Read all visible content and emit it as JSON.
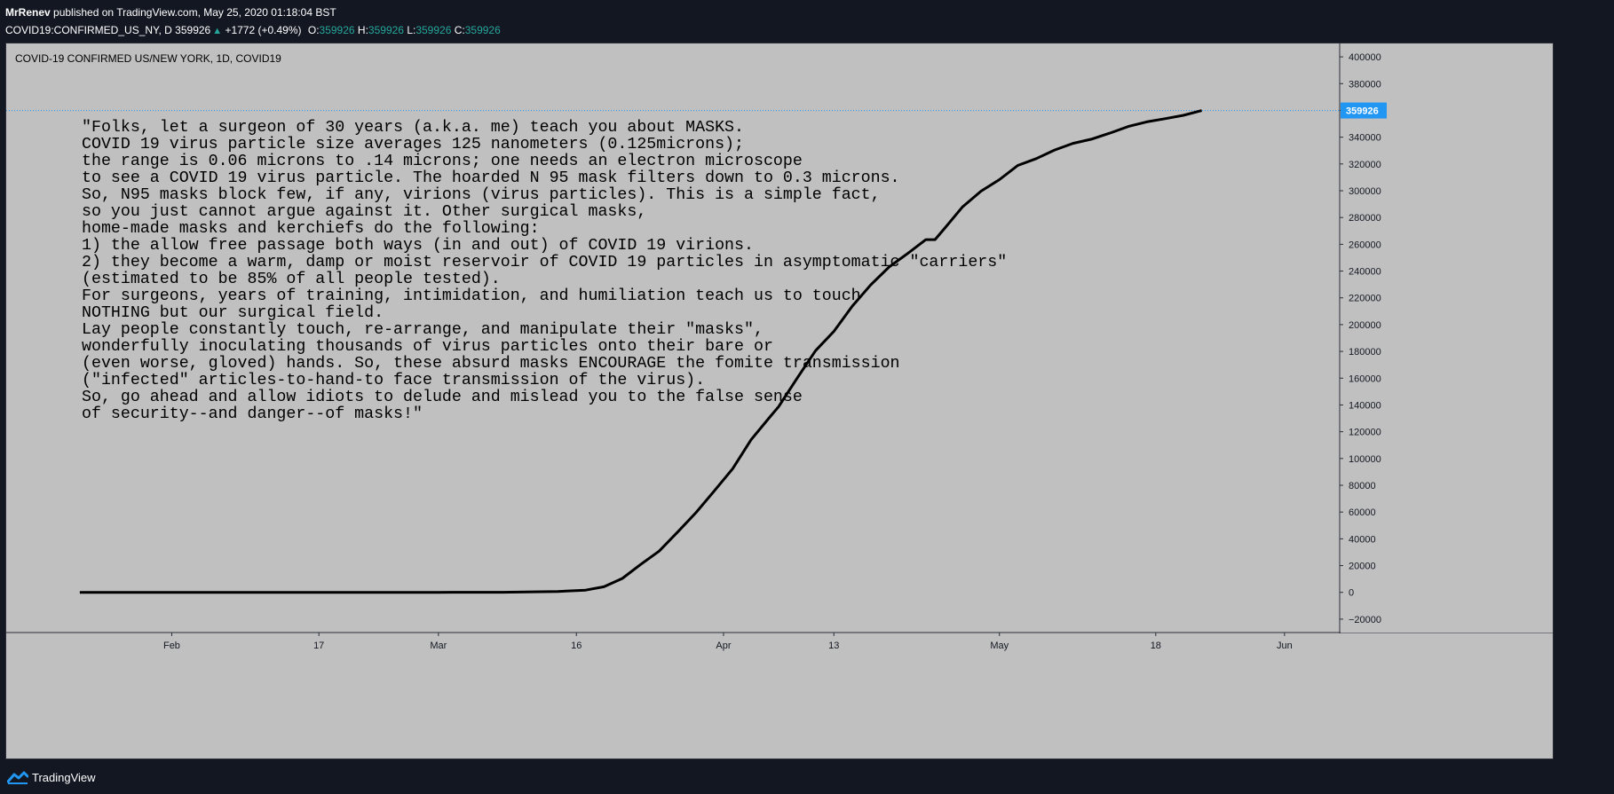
{
  "header": {
    "author": "MrRenev",
    "published": "published on TradingView.com, May 25, 2020 01:18:04 BST",
    "symbol": "COVID19:CONFIRMED_US_NY, D",
    "last": "359926",
    "change_arrow": "▲",
    "change": "+1772 (+0.49%)",
    "open_label": "O:",
    "open": "359926",
    "high_label": "H:",
    "high": "359926",
    "low_label": "L:",
    "low": "359926",
    "close_label": "C:",
    "close": "359926"
  },
  "footer": {
    "brand": "TradingView",
    "logo_icon": "tradingview-logo-icon"
  },
  "colors": {
    "background": "#131722",
    "plot_background": "#c0c0c0",
    "line": "#000000",
    "price_label": "#2196f3",
    "up": "#26a69a"
  },
  "chart_data": {
    "type": "line",
    "title": "COVID-19 CONFIRMED US/NEW YORK, 1D, COVID19",
    "ylim": [
      -30000,
      410000
    ],
    "y_ticks": [
      -20000,
      0,
      20000,
      40000,
      60000,
      80000,
      100000,
      120000,
      140000,
      160000,
      180000,
      200000,
      220000,
      240000,
      260000,
      280000,
      300000,
      320000,
      340000,
      360000,
      380000,
      400000
    ],
    "y_tick_labels": [
      "−20000",
      "0",
      "20000",
      "40000",
      "60000",
      "80000",
      "100000",
      "120000",
      "140000",
      "160000",
      "180000",
      "200000",
      "220000",
      "240000",
      "260000",
      "280000",
      "300000",
      "320000",
      "340000",
      "360000",
      "380000",
      "400000"
    ],
    "xlim": [
      "2020-01-14",
      "2020-06-07"
    ],
    "x_ticks": [
      {
        "date": "2020-02-01",
        "label": "Feb"
      },
      {
        "date": "2020-02-17",
        "label": "17"
      },
      {
        "date": "2020-03-01",
        "label": "Mar"
      },
      {
        "date": "2020-03-16",
        "label": "16"
      },
      {
        "date": "2020-04-01",
        "label": "Apr"
      },
      {
        "date": "2020-04-13",
        "label": "13"
      },
      {
        "date": "2020-05-01",
        "label": "May"
      },
      {
        "date": "2020-05-18",
        "label": "18"
      },
      {
        "date": "2020-06-01",
        "label": "Jun"
      }
    ],
    "last_value_label": "359926",
    "last_value": 359926,
    "series": [
      {
        "points": [
          [
            "2020-01-22",
            0
          ],
          [
            "2020-02-15",
            0
          ],
          [
            "2020-03-01",
            0
          ],
          [
            "2020-03-08",
            100
          ],
          [
            "2020-03-14",
            700
          ],
          [
            "2020-03-17",
            1700
          ],
          [
            "2020-03-19",
            4200
          ],
          [
            "2020-03-21",
            10400
          ],
          [
            "2020-03-23",
            20900
          ],
          [
            "2020-03-25",
            30800
          ],
          [
            "2020-03-27",
            45000
          ],
          [
            "2020-03-29",
            59500
          ],
          [
            "2020-03-31",
            75800
          ],
          [
            "2020-04-02",
            92400
          ],
          [
            "2020-04-04",
            114000
          ],
          [
            "2020-04-06",
            130700
          ],
          [
            "2020-04-07",
            138800
          ],
          [
            "2020-04-09",
            159900
          ],
          [
            "2020-04-11",
            180500
          ],
          [
            "2020-04-13",
            195000
          ],
          [
            "2020-04-15",
            213800
          ],
          [
            "2020-04-17",
            229600
          ],
          [
            "2020-04-19",
            243000
          ],
          [
            "2020-04-21",
            253000
          ],
          [
            "2020-04-23",
            263500
          ],
          [
            "2020-04-24",
            263500
          ],
          [
            "2020-04-25",
            271600
          ],
          [
            "2020-04-27",
            288000
          ],
          [
            "2020-04-29",
            299700
          ],
          [
            "2020-05-01",
            308300
          ],
          [
            "2020-05-03",
            318900
          ],
          [
            "2020-05-05",
            324000
          ],
          [
            "2020-05-07",
            330400
          ],
          [
            "2020-05-09",
            335400
          ],
          [
            "2020-05-11",
            338500
          ],
          [
            "2020-05-13",
            343000
          ],
          [
            "2020-05-15",
            348000
          ],
          [
            "2020-05-17",
            351400
          ],
          [
            "2020-05-19",
            353800
          ],
          [
            "2020-05-21",
            356300
          ],
          [
            "2020-05-23",
            359926
          ]
        ]
      }
    ],
    "annotation_lines": [
      "\"Folks, let a surgeon of 30 years (a.k.a. me) teach you about MASKS.",
      "COVID 19 virus particle size averages 125 nanometers (0.125microns);",
      "the range is 0.06 microns to .14 microns; one needs an electron microscope",
      "to see a COVID 19 virus particle. The hoarded N 95 mask filters down to 0.3 microns.",
      "So, N95 masks block few, if any, virions (virus particles). This is a simple fact,",
      "so you just cannot argue against it. Other surgical masks,",
      "home-made masks and kerchiefs do the following:",
      "1) the allow free passage both ways (in and out) of COVID 19 virions.",
      "2) they become a warm, damp or moist reservoir of COVID 19 particles in asymptomatic \"carriers\"",
      "(estimated to be 85% of all people tested).",
      "For surgeons, years of training, intimidation, and humiliation teach us to touch",
      "NOTHING but our surgical field.",
      "Lay people constantly touch, re-arrange, and manipulate their \"masks\",",
      "wonderfully inoculating thousands of virus particles onto their bare or",
      "(even worse, gloved) hands. So, these absurd masks ENCOURAGE the fomite transmission",
      "(\"infected\" articles-to-hand-to face transmission of the virus).",
      "So, go ahead and allow idiots to delude and mislead you to the false sense",
      "of security--and danger--of masks!\""
    ]
  }
}
